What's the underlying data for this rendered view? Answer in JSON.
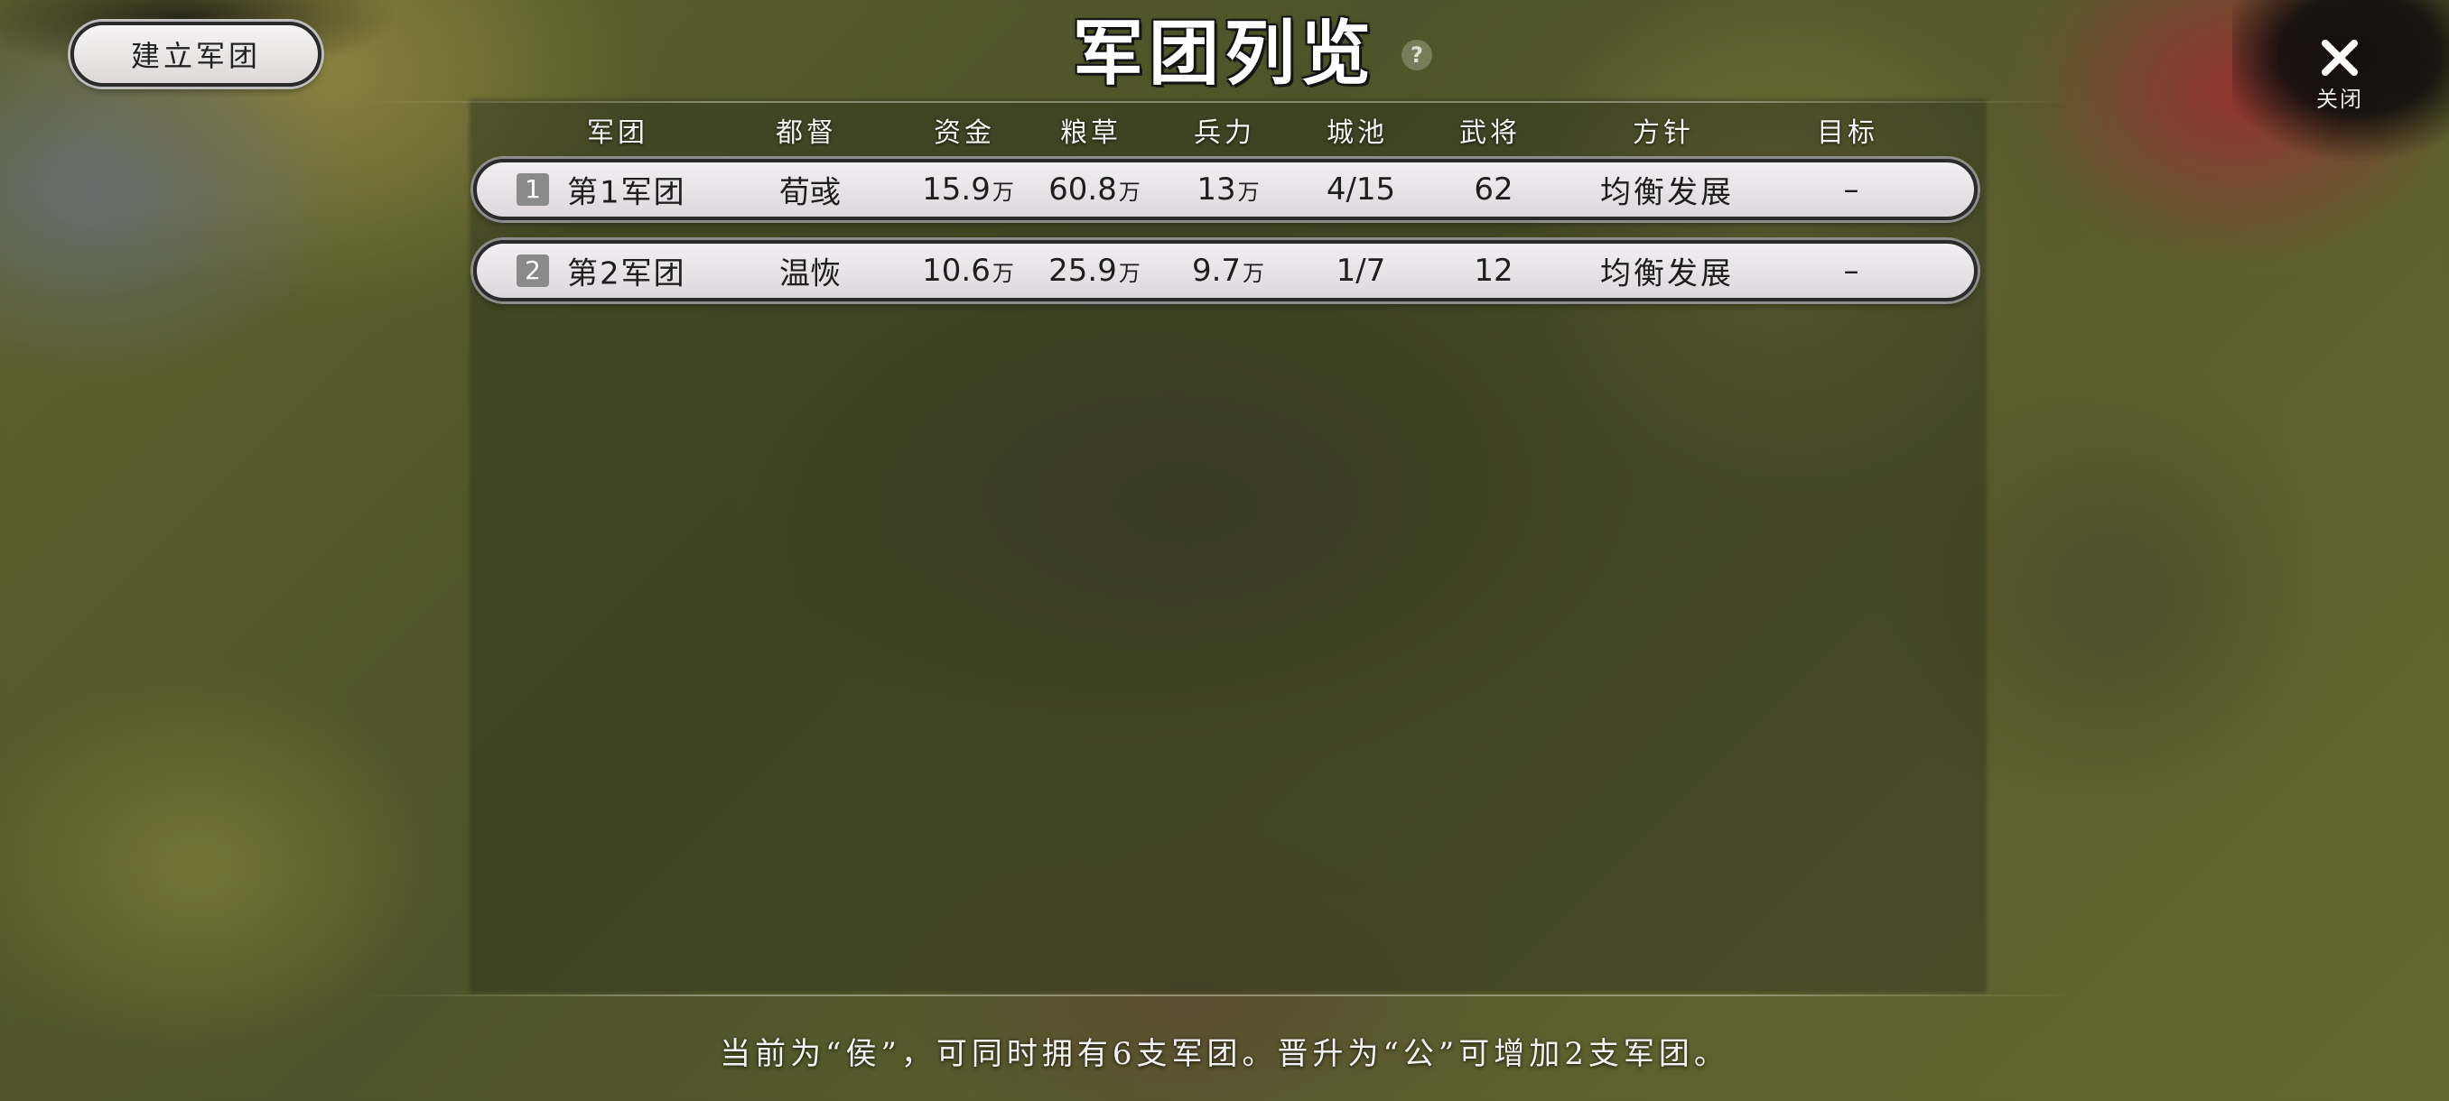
{
  "header": {
    "create_button": "建立军团",
    "title": "军团列览",
    "help_icon": "?",
    "close_label": "关闭"
  },
  "table": {
    "columns": [
      "军团",
      "都督",
      "资金",
      "粮草",
      "兵力",
      "城池",
      "武将",
      "方针",
      "目标"
    ],
    "rows": [
      {
        "index": "1",
        "name": "第1军团",
        "commander": "荀彧",
        "funds_value": "15.9",
        "funds_unit": "万",
        "food_value": "60.8",
        "food_unit": "万",
        "troops_value": "13",
        "troops_unit": "万",
        "cities": "4/15",
        "generals": "62",
        "policy": "均衡发展",
        "target": "–"
      },
      {
        "index": "2",
        "name": "第2军团",
        "commander": "温恢",
        "funds_value": "10.6",
        "funds_unit": "万",
        "food_value": "25.9",
        "food_unit": "万",
        "troops_value": "9.7",
        "troops_unit": "万",
        "cities": "1/7",
        "generals": "12",
        "policy": "均衡发展",
        "target": "–"
      }
    ]
  },
  "footer": {
    "note": "当前为“侯”，可同时拥有6支军团。晋升为“公”可增加2支军团。"
  },
  "icons": {
    "close": "close-icon",
    "help": "help-icon"
  }
}
